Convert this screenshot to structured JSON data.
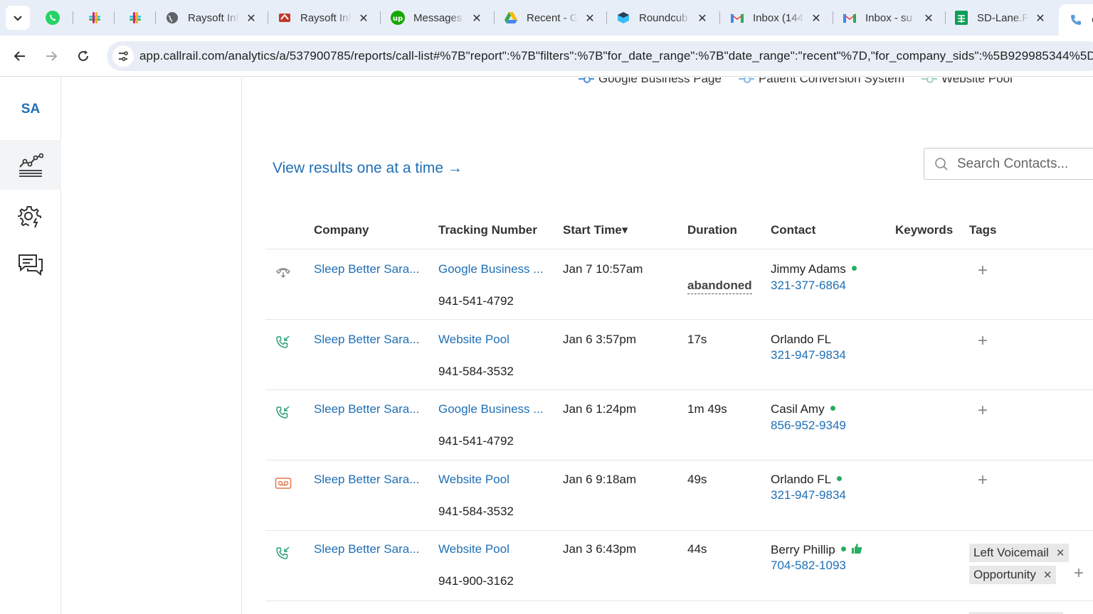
{
  "browser": {
    "tabs": [
      {
        "title": "Raysoft Inf",
        "icon": "globe-icon"
      },
      {
        "title": "Raysoft Inf",
        "icon": "raysoft-icon"
      },
      {
        "title": "Messages",
        "icon": "upwork-icon"
      },
      {
        "title": "Recent - G",
        "icon": "google-drive-icon"
      },
      {
        "title": "Roundcub",
        "icon": "roundcube-icon"
      },
      {
        "title": "Inbox (144",
        "icon": "gmail-icon"
      },
      {
        "title": "Inbox - su",
        "icon": "gmail-icon"
      },
      {
        "title": "SD-Lane.R",
        "icon": "sheets-icon"
      },
      {
        "title": "C",
        "icon": "callrail-icon"
      }
    ],
    "url": "app.callrail.com/analytics/a/537900785/reports/call-list#%7B\"report\":%7B\"filters\":%7B\"for_date_range\":%7B\"date_range\":\"recent\"%7D,\"for_company_sids\":%5B929985344%5D"
  },
  "rail": {
    "initials": "SA"
  },
  "legend": [
    {
      "label": "Google Business Page"
    },
    {
      "label": "Patient Conversion System"
    },
    {
      "label": "Website Pool"
    }
  ],
  "view_link": "View results one at a time →",
  "search": {
    "placeholder": "Search Contacts..."
  },
  "table": {
    "headers": {
      "company": "Company",
      "tracking": "Tracking Number",
      "start": "Start Time▾",
      "duration": "Duration",
      "contact": "Contact",
      "keywords": "Keywords",
      "tags": "Tags"
    },
    "rows": [
      {
        "type": "abandoned-call",
        "company": "Sleep Better Sara...",
        "source": "Google Business ...",
        "number": "941-541-4792",
        "start": "Jan 7 10:57am",
        "duration": "abandoned",
        "contact_name": "Jimmy Adams",
        "contact_phone": "321-377-6864",
        "tags": []
      },
      {
        "type": "inbound-call",
        "company": "Sleep Better Sara...",
        "source": "Website Pool",
        "number": "941-584-3532",
        "start": "Jan 6 3:57pm",
        "duration": "17s",
        "contact_name": "Orlando FL",
        "contact_phone": "321-947-9834",
        "tags": []
      },
      {
        "type": "inbound-call",
        "company": "Sleep Better Sara...",
        "source": "Google Business ...",
        "number": "941-541-4792",
        "start": "Jan 6 1:24pm",
        "duration": "1m 49s",
        "contact_name": "Casil Amy",
        "contact_phone": "856-952-9349",
        "tags": []
      },
      {
        "type": "voicemail",
        "company": "Sleep Better Sara...",
        "source": "Website Pool",
        "number": "941-584-3532",
        "start": "Jan 6 9:18am",
        "duration": "49s",
        "contact_name": "Orlando FL",
        "contact_phone": "321-947-9834",
        "tags": []
      },
      {
        "type": "inbound-call",
        "company": "Sleep Better Sara...",
        "source": "Website Pool",
        "number": "941-900-3162",
        "start": "Jan 3 6:43pm",
        "duration": "44s",
        "contact_name": "Berry Phillip",
        "contact_phone": "704-582-1093",
        "tags": [
          "Left Voicemail",
          "Opportunity"
        ]
      }
    ]
  },
  "colors": {
    "link": "#1f6fb5",
    "online_dot": "#27ae60",
    "call_icon": "#2e9e7a",
    "voicemail_icon": "#e07a4f"
  }
}
